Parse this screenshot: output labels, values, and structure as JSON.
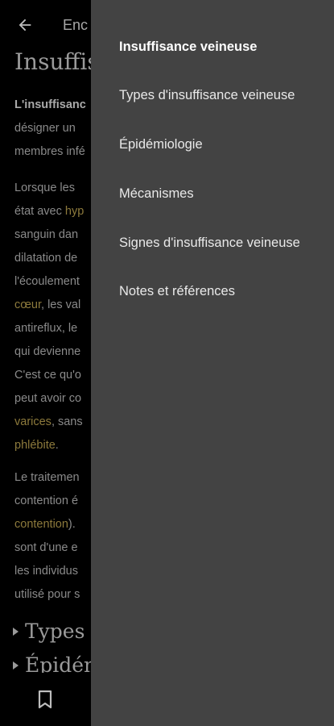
{
  "topbar": {
    "title": "Enc"
  },
  "article": {
    "title": "Insuffis",
    "p1": [
      "L'insuffisanc",
      "désigner un",
      "membres infé"
    ],
    "p2": [
      {
        "text": "Lorsque les",
        "link": ""
      },
      {
        "text": "état avec ",
        "link": "hyp"
      },
      {
        "text": "sanguin dan",
        "link": ""
      },
      {
        "text": "dilatation de",
        "link": ""
      },
      {
        "text": "l'écoulement",
        "link": ""
      },
      {
        "text": "",
        "link": "cœur",
        "after": ", les val"
      },
      {
        "text": "antireflux, le",
        "link": ""
      },
      {
        "text": "qui devienne",
        "link": ""
      },
      {
        "text": "C'est ce qu'o",
        "link": ""
      },
      {
        "text": "peut avoir co",
        "link": ""
      },
      {
        "text": "",
        "link": "varices",
        "after": ", sans"
      },
      {
        "text": "",
        "link": "phlébite",
        "after": "."
      }
    ],
    "p3": [
      {
        "text": "Le traitemen",
        "link": ""
      },
      {
        "text": "contention é",
        "link": ""
      },
      {
        "text": "",
        "link": "contention",
        "after": ")."
      },
      {
        "text": "sont d'une e",
        "link": ""
      },
      {
        "text": "les individus",
        "link": ""
      },
      {
        "text": "utilisé pour s",
        "link": ""
      }
    ],
    "sections": [
      "Types d",
      "Épidém"
    ]
  },
  "drawer": {
    "items": [
      "Insuffisance veineuse",
      "Types d'insuffisance veineuse",
      "Épidémiologie",
      "Mécanismes",
      "Signes d'insuffisance veineuse",
      "Notes et références"
    ]
  }
}
